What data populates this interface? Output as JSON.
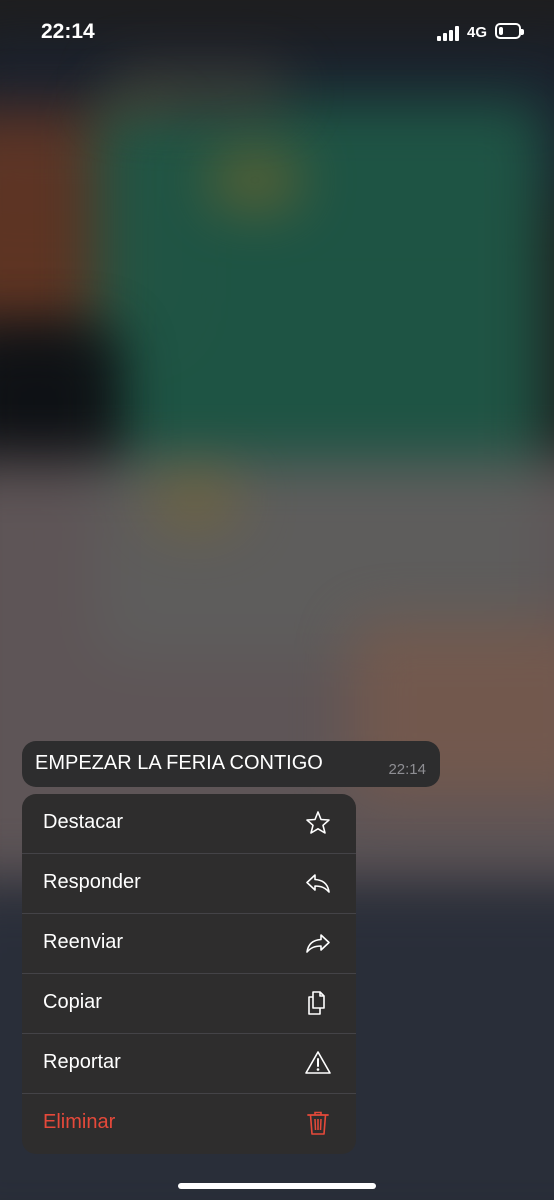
{
  "status_bar": {
    "time": "22:14",
    "network": "4G",
    "battery_level": 0.2
  },
  "message": {
    "text": "EMPEZAR LA FERIA CONTIGO",
    "time": "22:14"
  },
  "menu": {
    "items": [
      {
        "label": "Destacar",
        "icon": "star-icon"
      },
      {
        "label": "Responder",
        "icon": "reply-icon"
      },
      {
        "label": "Reenviar",
        "icon": "forward-icon"
      },
      {
        "label": "Copiar",
        "icon": "copy-icon"
      },
      {
        "label": "Reportar",
        "icon": "warning-icon"
      },
      {
        "label": "Eliminar",
        "icon": "trash-icon"
      }
    ]
  },
  "colors": {
    "danger": "#e5493a",
    "menu_bg": "#2e2d2d"
  }
}
